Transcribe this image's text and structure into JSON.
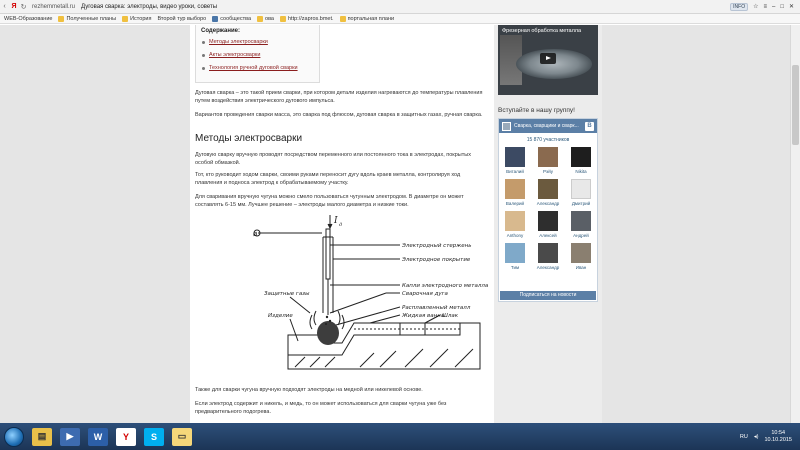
{
  "browser": {
    "url": "rezhemmetall.ru",
    "tab_title": "Дуговая сварка: электроды, видео уроки, советы",
    "menu_badge": "INFO"
  },
  "bookmarks": [
    "WEB-Образование",
    "Полученные планы",
    "История",
    "Второй тур выборо",
    "сообщества",
    "ова",
    "http://zapros.bmet.",
    "портальная плани"
  ],
  "toc": {
    "title": "Содержание:",
    "items": [
      "Методы электросварки",
      "Акты электросварки",
      "Технология ручной дуговой сварки"
    ]
  },
  "article": {
    "p1": "Дуговая сварка – это такой прием сварки, при котором детали изделия нагреваются до температуры плавления путем воздействия электрического дугового импульса.",
    "p2": "Вариантов проведения сварки масса, это сварка под флюсом, дуговая сварка в защитных газах, ручная сварка.",
    "heading": "Методы электросварки",
    "p3": "Дуговую сварку вручную проводят посредством переменного или постоянного тока в электродах, покрытых особой обмазкой.",
    "p4": "Тот, кто руководит ходом сварки, своими руками переносит дугу вдоль краев металла, контролируя ход плавления и подноса электрод к обрабатываемому участку.",
    "p5": "Для сваривания вручную чугуна можно смело пользоваться чугунным электродом. В диаметре он может составлять 6-15 мм. Лучшее решение – электроды малого диаметра и низкие токи.",
    "p6": "Также для сварки чугуна вручную подходят электроды на медной или никелевой основе.",
    "p7": "Если электрод содержит и никель, и медь, то он может использоваться для сварки чугуна уже без предварительного подогрева."
  },
  "diagram": {
    "current_label": "I",
    "current_sub": "д",
    "labels": [
      "Электродный стержень",
      "Электродное покрытие",
      "Капли электродного металла",
      "Сварочная дуга",
      "Расплавленный металл",
      "Жидкая ванна",
      "Шлак",
      "Защитные газы",
      "Изделие"
    ],
    "left_symbol": "ø"
  },
  "sidebar": {
    "video_title": "Фрезерная обработка металла",
    "join_label": "Вступайте в нашу группу!",
    "vk": {
      "group_name": "Сварка, сварщики и сварк...",
      "vk_logo": "В",
      "members_count": "15 870 участников",
      "members": [
        "Виталий",
        "Рэйу",
        "Nikita",
        "Валерий",
        "Александр",
        "Дмитрий",
        "Anthony",
        "Алексей",
        "Андрей",
        "Тим",
        "Александр",
        "Иван"
      ],
      "subscribe": "Подписаться на новости"
    }
  },
  "taskbar": {
    "lang": "RU",
    "time": "10:54",
    "date": "10.10.2015"
  }
}
